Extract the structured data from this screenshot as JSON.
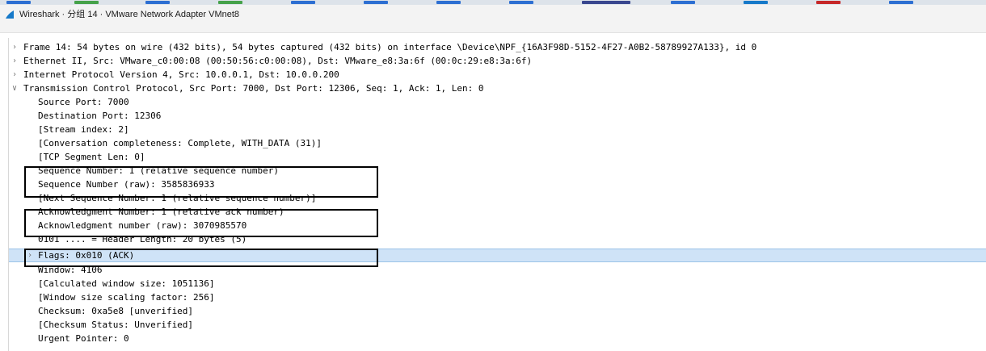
{
  "window": {
    "title": "Wireshark · 分组 14 · VMware Network Adapter VMnet8"
  },
  "tree": {
    "frame": "Frame 14: 54 bytes on wire (432 bits), 54 bytes captured (432 bits) on interface \\Device\\NPF_{16A3F98D-5152-4F27-A0B2-58789927A133}, id 0",
    "ethernet": "Ethernet II, Src: VMware_c0:00:08 (00:50:56:c0:00:08), Dst: VMware_e8:3a:6f (00:0c:29:e8:3a:6f)",
    "ip": "Internet Protocol Version 4, Src: 10.0.0.1, Dst: 10.0.0.200",
    "tcp": "Transmission Control Protocol, Src Port: 7000, Dst Port: 12306, Seq: 1, Ack: 1, Len: 0",
    "fields": {
      "src_port": "Source Port: 7000",
      "dst_port": "Destination Port: 12306",
      "stream_index": "[Stream index: 2]",
      "conv_completeness": "[Conversation completeness: Complete, WITH_DATA (31)]",
      "seg_len": "[TCP Segment Len: 0]",
      "seq_num": "Sequence Number: 1    (relative sequence number)",
      "seq_raw": "Sequence Number (raw): 3585836933",
      "next_seq": "[Next Sequence Number: 1    (relative sequence number)]",
      "ack_num": "Acknowledgment Number: 1    (relative ack number)",
      "ack_raw": "Acknowledgment number (raw): 3070985570",
      "header_len": "0101 .... = Header Length: 20 bytes (5)",
      "flags": "Flags: 0x010 (ACK)",
      "window": "Window: 4106",
      "calc_window": "[Calculated window size: 1051136]",
      "window_scaling": "[Window size scaling factor: 256]",
      "checksum": "Checksum: 0xa5e8 [unverified]",
      "checksum_status": "[Checksum Status: Unverified]",
      "urgent": "Urgent Pointer: 0"
    }
  },
  "icons": {
    "collapsed": "chevron-right-icon",
    "expanded": "chevron-down-icon",
    "app": "wireshark-fin-icon"
  },
  "colors": {
    "selection": "#cfe3f7",
    "selection_border": "#9cc3e8",
    "annotation_box": "#000000",
    "fin_blue": "#1679c9"
  }
}
